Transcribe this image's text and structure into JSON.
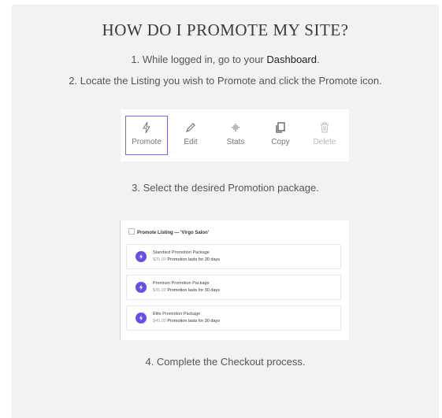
{
  "title": "HOW DO I PROMOTE MY SITE?",
  "steps": {
    "step1_pre": "1. While logged in, go to your ",
    "step1_link": "Dashboard",
    "step1_post": ".",
    "step2": "2. Locate the Listing you wish to Promote and click the Promote icon.",
    "step3": "3. Select the desired Promotion package.",
    "step4": "4. Complete the Checkout process."
  },
  "toolbar": {
    "items": [
      {
        "label": "Promote",
        "icon": "lightning-icon",
        "active": true
      },
      {
        "label": "Edit",
        "icon": "pencil-icon"
      },
      {
        "label": "Stats",
        "icon": "waveform-icon"
      },
      {
        "label": "Copy",
        "icon": "copy-icon"
      },
      {
        "label": "Delete",
        "icon": "trash-icon",
        "disabled": true
      }
    ]
  },
  "promotion": {
    "heading": "Promote Listing — 'Virgo Salon'",
    "packages": [
      {
        "name": "Standard Promotion Package",
        "price": "$25.00",
        "duration": "Promotion lasts for 30 days"
      },
      {
        "name": "Premium Promotion Package",
        "price": "$35.00",
        "duration": "Promotion lasts for 30 days"
      },
      {
        "name": "Elite Promotion Package",
        "price": "$45.00",
        "duration": "Promotion lasts for 30 days"
      }
    ]
  },
  "colors": {
    "accent": "#6b4ee6",
    "active_border": "#7b62e0",
    "panel_bg": "#f2f2f2"
  }
}
